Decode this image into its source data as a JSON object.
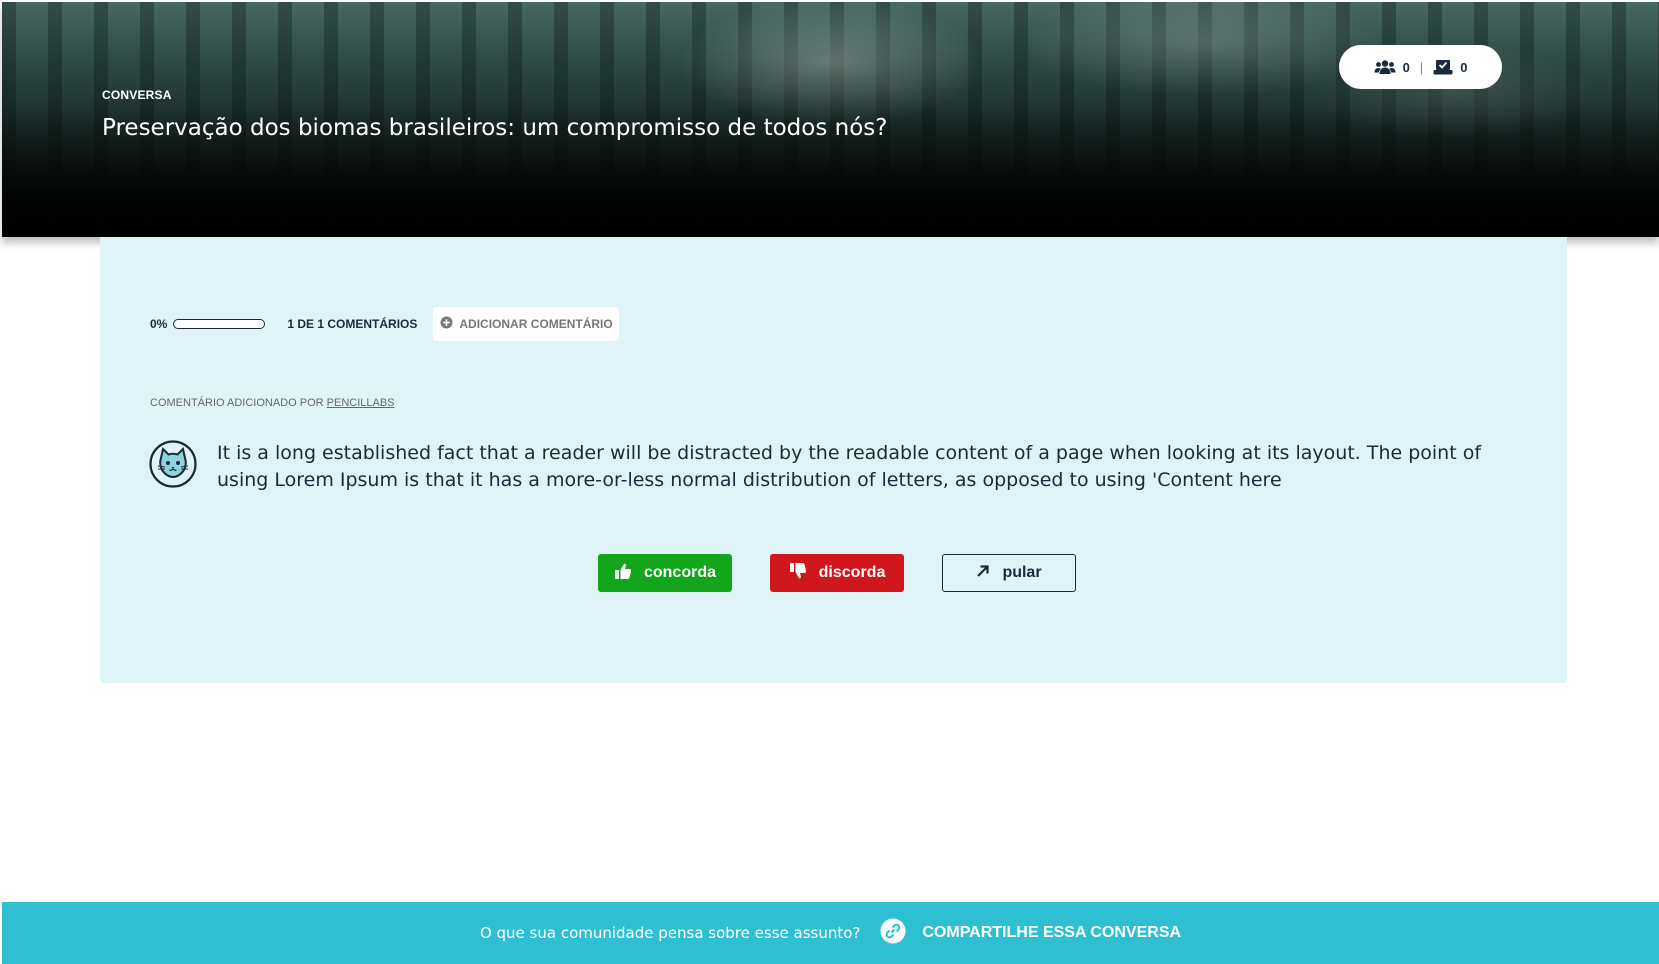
{
  "header": {
    "label": "CONVERSA",
    "title": "Preservação dos biomas brasileiros: um compromisso de todos nós?",
    "stats": {
      "participants": "0",
      "votes": "0",
      "separator": "|"
    }
  },
  "progress": {
    "percent_label": "0%",
    "percent_value": 0,
    "count_label": "1 DE 1 COMENTÁRIOS",
    "add_comment_label": "ADICIONAR COMENTÁRIO"
  },
  "comment": {
    "author_prefix": "COMENTÁRIO ADICIONADO POR",
    "author_name": "PENCILLABS",
    "text": "It is a long established fact that a reader will be distracted by the readable content of a page when looking at its layout. The point of using Lorem Ipsum is that it has a more-or-less normal distribution of letters, as opposed to using 'Content here"
  },
  "actions": {
    "agree_label": "concorda",
    "disagree_label": "discorda",
    "skip_label": "pular"
  },
  "footer": {
    "question": "O que sua comunidade pensa sobre esse assunto?",
    "share_label": "COMPARTILHE ESSA CONVERSA"
  },
  "colors": {
    "card_bg": "#e0f4f7",
    "agree": "#13a51a",
    "disagree": "#d1171e",
    "footer_bg": "#2fbfd3",
    "text_dark": "#1b2a3a"
  },
  "icons": {
    "participants": "users-icon",
    "votes": "vote-inbox-icon",
    "add": "plus-circle-icon",
    "avatar": "cat-avatar-icon",
    "agree": "thumbs-up-icon",
    "disagree": "thumbs-down-icon",
    "skip": "arrow-up-right-icon",
    "share": "link-icon"
  }
}
